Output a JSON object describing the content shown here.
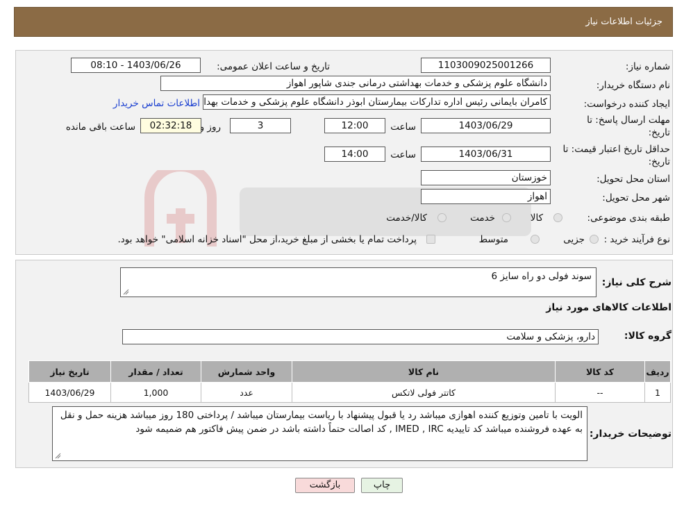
{
  "header": {
    "title": "جزئیات اطلاعات نیاز"
  },
  "fields": {
    "need_number_label": "شماره نیاز:",
    "need_number": "1103009025001266",
    "announce_label": "تاریخ و ساعت اعلان عمومی:",
    "announce_value": "1403/06/26 - 08:10",
    "buyer_org_label": "نام دستگاه خریدار:",
    "buyer_org": "دانشگاه علوم پزشکی و خدمات بهداشتی درمانی جندی شاپور اهواز",
    "creator_label": "ایجاد کننده درخواست:",
    "creator": "کامران بایمانی رئیس اداره تدارکات بیمارستان ابوذر  دانشگاه علوم پزشکی و خدمات بهداشتی",
    "contact_link": "اطلاعات تماس خریدار",
    "deadline_label_1": "مهلت ارسال پاسخ: تا",
    "deadline_label_2": "تاریخ:",
    "deadline_date": "1403/06/29",
    "time_word": "ساعت",
    "deadline_time": "12:00",
    "days_value": "3",
    "days_word": "روز و",
    "remaining_time": "02:32:18",
    "remaining_word": "ساعت باقی مانده",
    "validity_label_1": "حداقل تاریخ اعتبار قیمت: تا",
    "validity_label_2": "تاریخ:",
    "validity_date": "1403/06/31",
    "validity_time": "14:00",
    "province_label": "استان محل تحویل:",
    "province": "خوزستان",
    "city_label": "شهر محل تحویل:",
    "city": "اهواز",
    "category_label": "طبقه بندی موضوعی:",
    "category_options": [
      "کالا",
      "خدمت",
      "کالا/خدمت"
    ],
    "process_label": "نوع فرآیند خرید :",
    "process_options": [
      "جزیی",
      "متوسط"
    ],
    "process_note": "پرداخت تمام یا بخشی از مبلغ خرید،از محل \"اسناد خزانه اسلامی\" خواهد بود."
  },
  "summary": {
    "label": "شرح کلی نیاز:",
    "value": "سوند فولی دو راه سایز 6",
    "goods_info_title": "اطلاعات کالاهای مورد نیاز",
    "group_label": "گروه کالا:",
    "group_value": "دارو، پزشکی و سلامت"
  },
  "table": {
    "headers": [
      "ردیف",
      "کد کالا",
      "نام کالا",
      "واحد شمارش",
      "تعداد / مقدار",
      "تاریخ نیاز"
    ],
    "rows": [
      [
        "1",
        "--",
        "کاتتر فولی لاتکس",
        "عدد",
        "1,000",
        "1403/06/29"
      ]
    ]
  },
  "notes": {
    "label": "توضیحات خریدار:",
    "value": "الویت با تامین وتوزیع کننده اهوازی  میباشد رد یا قبول پیشنهاد با ریاست بیمارستان میباشد / پرداختی 180 روز   میباشد هزینه حمل و نقل به عهده فروشنده میباشد   کد تاییدیه IMED , IRC , کد اصالت حتماً داشته باشد در ضمن پیش فاکتور هم ضمیمه شود"
  },
  "buttons": {
    "print": "چاپ",
    "back": "بازگشت"
  },
  "colors": {
    "header_bg": "#8b6b45",
    "panel_bg": "#f2f2f2",
    "link": "#1a3fd0",
    "back_btn": "#f8dada",
    "print_btn": "#e6f3e3"
  }
}
